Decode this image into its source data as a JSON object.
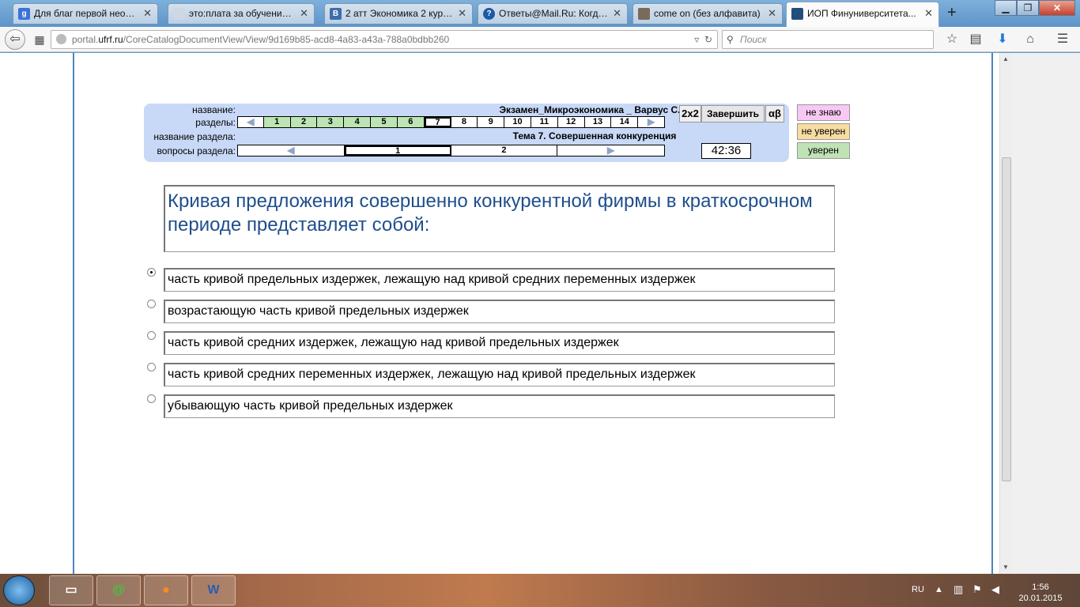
{
  "tabs": [
    {
      "label": "Для благ первой необх...",
      "fav": "g",
      "fav_color": "#3b73d8"
    },
    {
      "label": "это:плата за обучение и ут...",
      "fav": "",
      "fav_color": "#cfd8e2"
    },
    {
      "label": "2 атт Экономика 2 курс...",
      "fav": "B",
      "fav_color": "#3d6da8"
    },
    {
      "label": "Ответы@Mail.Ru: Когда...",
      "fav": "?",
      "fav_color": "#1d5aa8"
    },
    {
      "label": "come on (без алфавита)",
      "fav": "",
      "fav_color": "#7a6a5a"
    },
    {
      "label": "ИОП Финуниверситета...",
      "fav": "",
      "fav_color": "#244e7a"
    }
  ],
  "nav": {
    "url_domain": "portal.ufrf.ru",
    "url_path": "/CoreCatalogDocumentView/View/9d169b85-acd8-4a83-a43a-788a0bdbb260",
    "url_prefix": "portal.",
    "url_dom": "ufrf.ru",
    "search_placeholder": "Поиск"
  },
  "panel": {
    "label_name": "название:",
    "label_sections": "разделы:",
    "label_section_name": "название раздела:",
    "label_section_questions": "вопросы раздела:",
    "exam_title": "Экзамен_Микроэкономика _ Варвус С.А.",
    "section_title": "Тема 7. Совершенная конкуренция",
    "sections": [
      "1",
      "2",
      "3",
      "4",
      "5",
      "6",
      "7",
      "8",
      "9",
      "10",
      "11",
      "12",
      "13",
      "14"
    ],
    "sections_done": 6,
    "current_section": "7",
    "questions": [
      "1",
      "2"
    ],
    "current_question": "1",
    "btn_2x2": "2x2",
    "btn_finish": "Завершить",
    "btn_alpha": "αβ",
    "timer": "42:36"
  },
  "confidence": {
    "dont_know": "не знаю",
    "not_sure": "не уверен",
    "sure": "уверен"
  },
  "question": {
    "text": "Кривая предложения совершенно конкурентной фирмы в краткосрочном периоде представляет собой:",
    "answers": [
      "часть кривой предельных издержек, лежащую над кривой средних переменных издержек",
      "возрастающую часть кривой предельных издержек",
      "часть кривой средних издержек, лежащую над кривой предельных издержек",
      "часть кривой средних переменных издержек, лежащую над  кривой предельных издержек",
      "убывающую часть кривой предельных издержек"
    ],
    "selected": 0
  },
  "taskbar": {
    "lang": "RU",
    "time": "1:56",
    "date": "20.01.2015"
  }
}
